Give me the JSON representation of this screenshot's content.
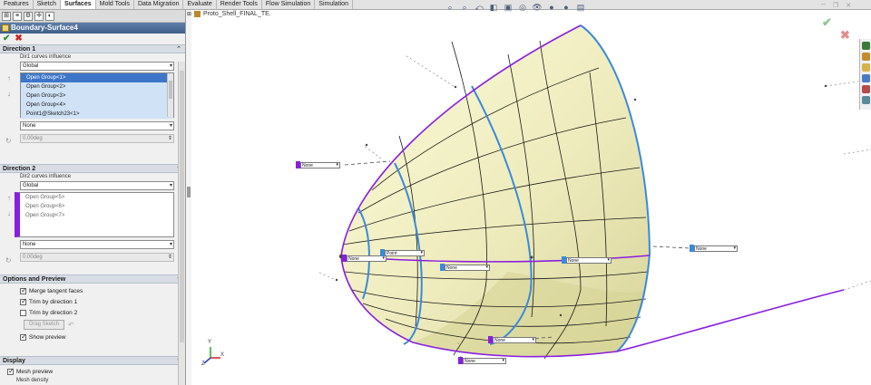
{
  "tabs": [
    "Features",
    "Sketch",
    "Surfaces",
    "Mold Tools",
    "Data Migration",
    "Evaluate",
    "Render Tools",
    "Flow Simulation",
    "Simulation"
  ],
  "active_tab_index": 2,
  "feature": {
    "title": "Boundary-Surface4"
  },
  "direction1": {
    "header": "Direction 1",
    "influence_label": "Dir1 curves influence",
    "influence_value": "Global",
    "curves": [
      "Open Group<1>",
      "Open Group<2>",
      "Open Group<3>",
      "Open Group<4>",
      "Point1@Sketch23<1>"
    ],
    "tangency_value": "None",
    "angle_value": "0.00deg"
  },
  "direction2": {
    "header": "Direction 2",
    "influence_label": "Dir2 curves influence",
    "influence_value": "Global",
    "curves": [
      "Open Group<5>",
      "Open Group<6>",
      "Open Group<7>"
    ],
    "tangency_value": "None",
    "angle_value": "0.00deg"
  },
  "options": {
    "header": "Options and Preview",
    "merge_tangent_faces": "Merge tangent faces",
    "trim_dir1": "Trim by direction 1",
    "trim_dir2": "Trim by direction 2",
    "drag_sketch": "Drag Sketch",
    "show_preview": "Show preview",
    "checked": {
      "merge": true,
      "trim1": true,
      "trim2": false,
      "preview": true
    }
  },
  "display": {
    "header": "Display",
    "mesh_preview": "Mesh preview",
    "mesh_density": "Mesh density"
  },
  "viewport": {
    "document_name": "Proto_Shell_FINAL_TE."
  },
  "connectors": [
    {
      "value": "None",
      "color": "purple"
    },
    {
      "value": "None",
      "color": "purple"
    },
    {
      "value": "Point",
      "color": "blue"
    },
    {
      "value": "None",
      "color": "blue"
    },
    {
      "value": "None",
      "color": "blue"
    },
    {
      "value": "None",
      "color": "blue"
    },
    {
      "value": "None",
      "color": "purple"
    },
    {
      "value": "None",
      "color": "purple"
    }
  ],
  "colors": {
    "purple_curve": "#8a1ee0",
    "blue_curve": "#3a8ad9",
    "surface": "#f2f0c0"
  },
  "triad": {
    "x": "X",
    "y": "Y",
    "z": "Z"
  }
}
